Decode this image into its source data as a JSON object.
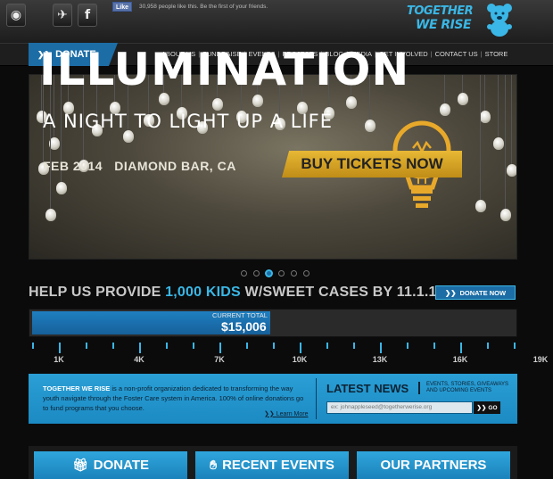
{
  "social": {
    "icons": [
      "instagram-icon",
      "bird-icon",
      "facebook-icon"
    ],
    "fb_like_label": "Like",
    "fb_text": "30,958 people like this. Be the first of your friends."
  },
  "brand": {
    "logo_line1": "TOGETHER",
    "logo_line2": "WE RISE",
    "accent": "#3ab7e6"
  },
  "nav": {
    "donate_label": "DONATE",
    "items": [
      "ABOUT US",
      "FUNDRAISE",
      "EVENTS",
      "PROJECTS",
      "BLOG",
      "MEDIA",
      "GET INVOLVED",
      "CONTACT US",
      "STORE"
    ]
  },
  "banner": {
    "title": "ILLUMINATION",
    "subtitle": "A NIGHT TO LIGHT UP A LIFE",
    "date_location": "FEB 2014   DIAMOND BAR, CA",
    "cta": "BUY TICKETS NOW",
    "slide_count": 6,
    "active_slide": 3
  },
  "campaign": {
    "headline_pre": "HELP US PROVIDE ",
    "headline_highlight": "1,000 KIDS",
    "headline_post": " W/SWEET CASES BY 11.1.13",
    "donate_now": "DONATE NOW",
    "current_total_label": "CURRENT TOTAL",
    "current_total": "$15,006",
    "goal_progress": 0.49,
    "tick_labels": [
      "1K",
      "4K",
      "7K",
      "10K",
      "13K",
      "16K",
      "19K"
    ]
  },
  "info": {
    "org_name": "TOGETHER WE RISE",
    "description": " is a non-profit organization dedicated to transforming the way youth navigate through the Foster Care system in America. 100% of online donations go to fund programs that you choose.",
    "learn_more": "Learn More",
    "latest_news": "LATEST NEWS",
    "latest_sub": "EVENTS, STORIES, GIVEAWAYS AND UPCOMING EVENTS",
    "email_placeholder": "ex: johnappleseed@togetherwerise.org",
    "go_label": "GO"
  },
  "tiles": {
    "donate": "DONATE",
    "recent_events": "RECENT EVENTS",
    "our_partners": "OUR PARTNERS"
  }
}
